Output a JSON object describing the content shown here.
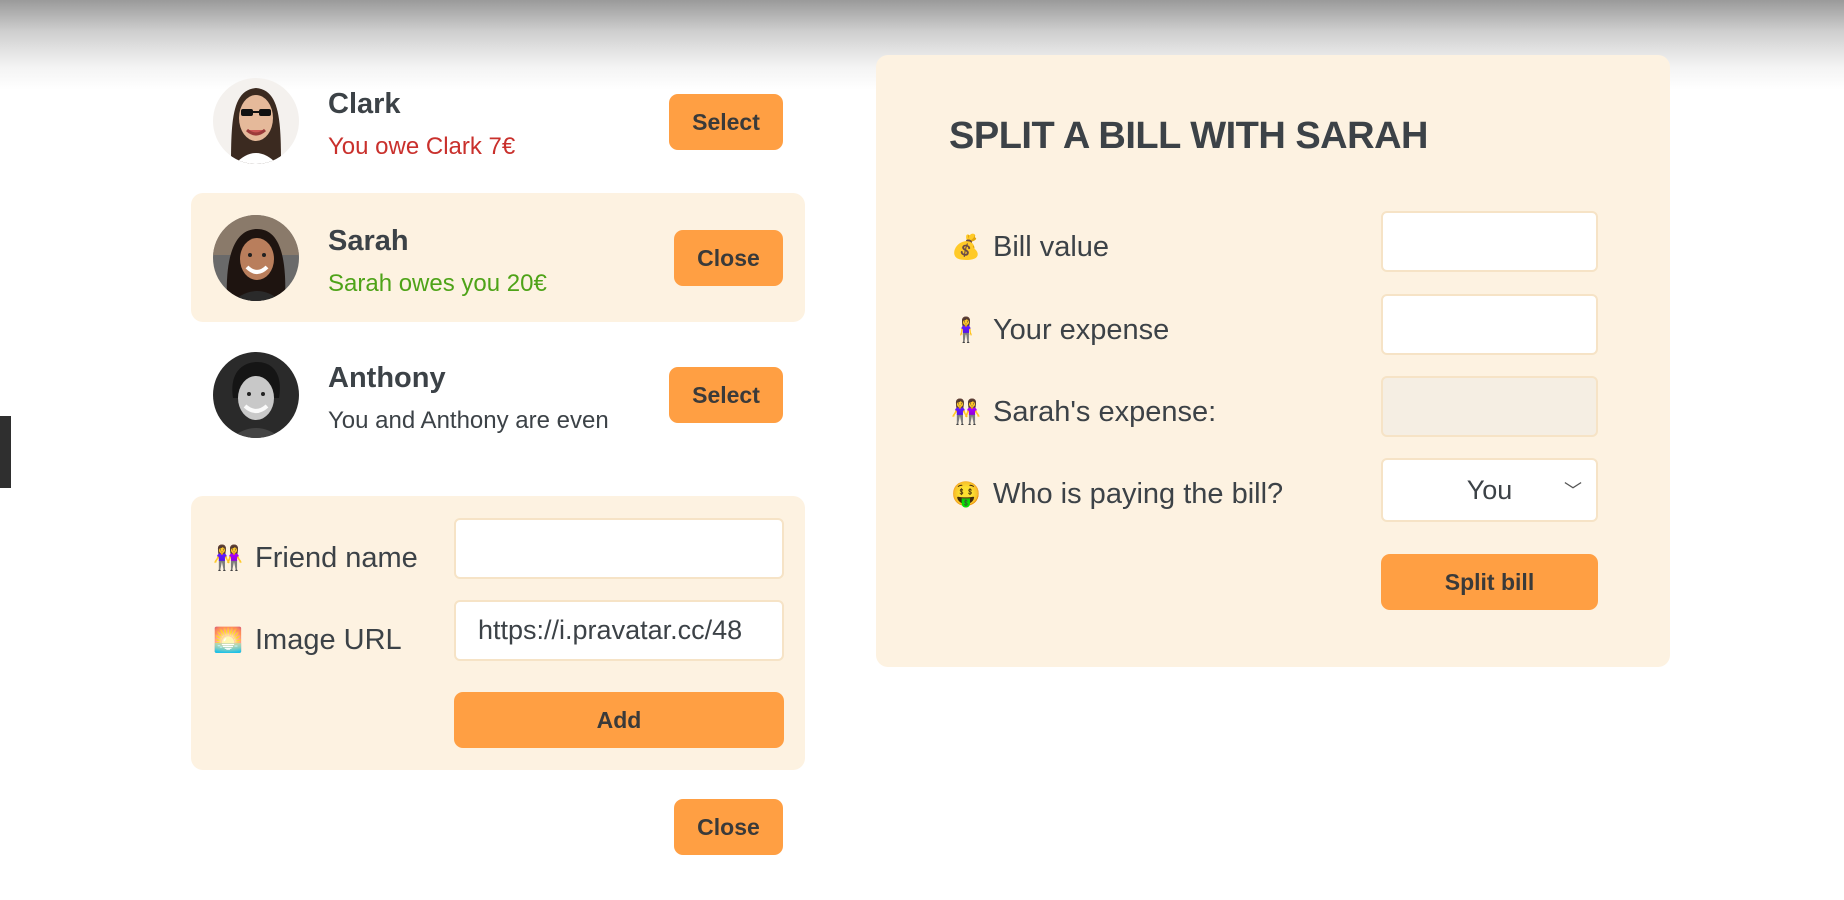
{
  "friends": [
    {
      "name": "Clark",
      "status": "You owe Clark 7€",
      "status_color": "#c9302c",
      "button": "Select",
      "selected": false
    },
    {
      "name": "Sarah",
      "status": "Sarah owes you 20€",
      "status_color": "#4ea318",
      "button": "Close",
      "selected": true
    },
    {
      "name": "Anthony",
      "status": "You and Anthony are even",
      "status_color": "#3c4247",
      "button": "Select",
      "selected": false
    }
  ],
  "add_friend": {
    "name_label": "Friend name",
    "name_value": "",
    "image_label": "Image URL",
    "image_value": "https://i.pravatar.cc/48",
    "add_button": "Add"
  },
  "close_button": "Close",
  "split": {
    "title": "SPLIT A BILL WITH SARAH",
    "bill_label": "Bill value",
    "bill_value": "",
    "your_label": "Your expense",
    "your_value": "",
    "friend_label": "Sarah's expense:",
    "friend_value": "",
    "payer_label": "Who is paying the bill?",
    "payer_value": "You",
    "split_button": "Split bill"
  },
  "colors": {
    "accent": "#ff9f43",
    "panel": "#fdf2e1"
  },
  "icons": {
    "bill": "money-bag-icon",
    "your": "person-icon",
    "friend": "two-people-icon",
    "payer": "money-mouth-face-icon",
    "friend_name": "two-people-icon",
    "image_url": "sunset-image-icon",
    "select_chevron": "chevron-down-icon"
  }
}
